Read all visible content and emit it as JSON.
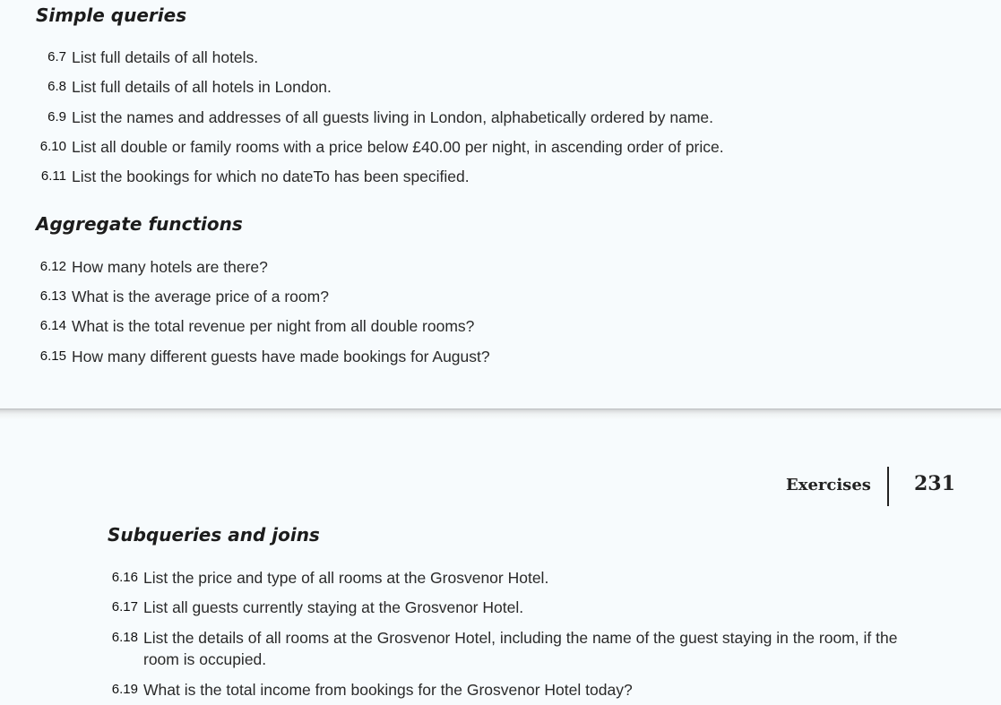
{
  "page_top": {
    "sections": [
      {
        "heading": "Simple queries",
        "items": [
          {
            "num": "6.7",
            "text": "List full details of all hotels."
          },
          {
            "num": "6.8",
            "text": "List full details of all hotels in London."
          },
          {
            "num": "6.9",
            "text": "List the names and addresses of all guests living in London, alphabetically ordered by name."
          },
          {
            "num": "6.10",
            "text": "List all double or family rooms with a price below £40.00 per night, in ascending order of price."
          },
          {
            "num": "6.11",
            "text": "List the bookings for which no dateTo has been specified."
          }
        ]
      },
      {
        "heading": "Aggregate functions",
        "items": [
          {
            "num": "6.12",
            "text": "How many hotels are there?"
          },
          {
            "num": "6.13",
            "text": "What is the average price of a room?"
          },
          {
            "num": "6.14",
            "text": "What is the total revenue per night from all double rooms?"
          },
          {
            "num": "6.15",
            "text": "How many different guests have made bookings for August?"
          }
        ]
      }
    ]
  },
  "page_bottom": {
    "running_head": {
      "label": "Exercises",
      "page_number": "231"
    },
    "sections": [
      {
        "heading": "Subqueries and joins",
        "items": [
          {
            "num": "6.16",
            "text": "List the price and type of all rooms at the Grosvenor Hotel."
          },
          {
            "num": "6.17",
            "text": "List all guests currently staying at the Grosvenor Hotel."
          },
          {
            "num": "6.18",
            "text": "List the details of all rooms at the Grosvenor Hotel, including the name of the guest staying in the room, if the",
            "continuation": "room is occupied."
          },
          {
            "num": "6.19",
            "text": "What is the total income from bookings for the Grosvenor Hotel today?"
          }
        ]
      }
    ]
  }
}
